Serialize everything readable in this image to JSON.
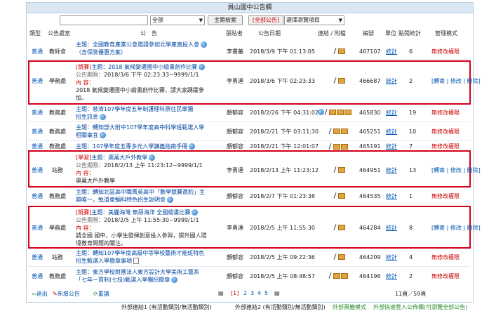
{
  "title": "員山國中公告欄",
  "search": {
    "value": "",
    "scope_select": "全部",
    "button": "主題檢索",
    "all_button": "[全部公告]",
    "filter_select": "選擇瀏覽項目"
  },
  "headers": {
    "type": "類型",
    "unit": "公告處室",
    "subject": "公　告",
    "poster": "張貼者",
    "date": "公告日期",
    "attach": "連結 / 附檔",
    "num": "編號",
    "stat": "單位",
    "hits": "點閱統計",
    "manage": "管理模式"
  },
  "rows": [
    {
      "type": "普通",
      "unit": "教師會",
      "line1": "主題：全國教育產業公會邀請參加北學產直投入會",
      "line2": "（含保險優惠方案）",
      "poster": "李書蓁",
      "date": "2018/3/9 下午 01:13:05",
      "num": "467107",
      "stat": "統計",
      "hits": "6",
      "manage": "無修改權限"
    },
    {
      "type": "普通",
      "unit": "學務處",
      "tag": "[競賽]",
      "line1": "主題：2018 氣候變遷國中小繪畫創作比賽",
      "period_label": "公告期限：",
      "period": "2018/3/6 下午 02:23:33~9999/1/1",
      "content_label": "內 容：",
      "content1": "2018 氣候變遷國中小繪畫創作比賽，請大家踴躍參",
      "content2": "加。",
      "poster": "李勇達",
      "date": "2018/3/6 下午 02:23:33",
      "num": "466687",
      "stat": "統計",
      "hits": "2",
      "manage": "[轉寄 | 修改 | 刪除]"
    },
    {
      "type": "普通",
      "unit": "教務處",
      "line1": "主題：慈濟107學年度五年制護理科原住民單獨",
      "line2": "招生訊息",
      "poster": "顏郁容",
      "date": "2018/2/26 下午 04:31:02",
      "num": "465830",
      "stat": "統計",
      "hits": "19",
      "manage": "無修改權限"
    },
    {
      "type": "普通",
      "unit": "教務處",
      "line1": "主題：轉知部大附中107學年度高中科學班甄選入學",
      "line2": "相關事宜",
      "poster": "顏郁容",
      "date": "2018/2/21 下午 03:11:30",
      "num": "465251",
      "stat": "統計",
      "hits": "10",
      "manage": "無修改權限"
    },
    {
      "type": "普通",
      "unit": "教務處",
      "line1": "主題：107學年度五專多元入學講義指南手冊",
      "poster": "顏郁容",
      "date": "2018/2/21 下午 12:01:07",
      "num": "465191",
      "stat": "統計",
      "hits": "7",
      "manage": "無修改權限"
    },
    {
      "type": "普通",
      "unit": "站務",
      "tag": "[學習]",
      "line1": "主題：奧萬大戶外教學",
      "period_label": "公告期限：",
      "period": "2018/2/13 上午 11:23:12~9999/1/1",
      "content_label": "內 容：",
      "content1": "奧萬大戶外教學",
      "poster": "李勇達",
      "date": "2018/2/13 上午 11:23:12",
      "num": "464951",
      "stat": "統計",
      "hits": "13",
      "manage": "[轉寄 | 修改 | 刪除]"
    },
    {
      "type": "普通",
      "unit": "教務處",
      "line1": "主題：轉知北區高中職菁英高中「數學競賽邀約」主",
      "line2": "題唯一，軌道車輛科特色招生說明會",
      "poster": "顏郁容",
      "date": "2018/2/7 下午 01:23:38",
      "num": "464535",
      "stat": "統計",
      "hits": "1",
      "manage": "無修改權限"
    },
    {
      "type": "普通",
      "unit": "學務處",
      "tag": "[競賽]",
      "line1": "主題：美麗海灣 無惡海洋 全國繪畫比賽",
      "period_label": "公告期限：",
      "period": "2018/2/5 上午 11:55:30~9999/1/1",
      "content_label": "內 容：",
      "content1": "請全國 國中、小學生發揮創意投入參與，提升國人環",
      "content2": "境教育問題的關注。",
      "poster": "李勇達",
      "date": "2018/2/5 上午 11:55:30",
      "num": "464284",
      "stat": "統計",
      "hits": "8",
      "manage": "[轉寄 | 修改 | 刪除]"
    },
    {
      "type": "普通",
      "unit": "站務",
      "line1": "主題：轉知107學年度高級中等學校藝術才能班特色",
      "line2": "招生甄選入學簡章事項",
      "poster": "顏郁容",
      "date": "2018/2/5 上午 09:22:36",
      "num": "464209",
      "stat": "統計",
      "hits": "4",
      "manage": "無修改權限"
    },
    {
      "type": "普通",
      "unit": "教務處",
      "line1": "主題：東方學校財團法人東方設計大學美術工藝系",
      "line2": "「七年一貫制(七技)甄選入學獨招簡章",
      "poster": "顏郁容",
      "date": "2018/2/5 上午 08:48:57",
      "num": "464196",
      "stat": "統計",
      "hits": "2",
      "manage": "無修改權限"
    }
  ],
  "footer": {
    "logout": "退出",
    "add": "新增公告",
    "reload": "重讀",
    "pages": [
      "[1]",
      "2",
      "3",
      "4",
      "5"
    ],
    "page_info": "11頁／59頁"
  },
  "bottom_links": {
    "link1": "外部連結1 (有活動類別/無活動類別)",
    "link2": "外部連結2 (有活動類別/無活動類別)",
    "link3": "外部頁籤模式",
    "link4": "外部快速登入公佈欄(可瀏覽全部公告)"
  }
}
